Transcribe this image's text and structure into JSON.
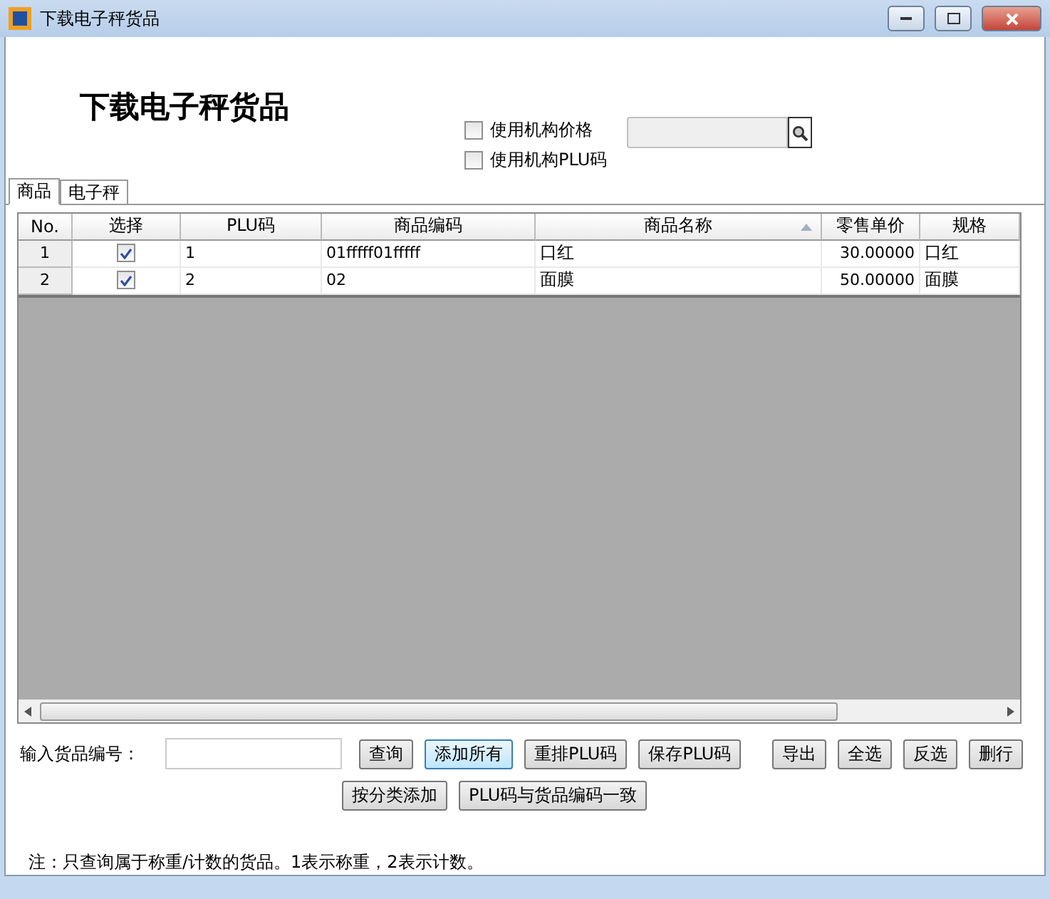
{
  "window": {
    "title": "下载电子秤货品"
  },
  "heading": "下载电子秤货品",
  "options": [
    {
      "label": "使用机构价格",
      "checked": false
    },
    {
      "label": "使用机构PLU码",
      "checked": false
    }
  ],
  "tabs": [
    {
      "label": "商品",
      "selected": true
    },
    {
      "label": "电子秤",
      "selected": false
    }
  ],
  "table": {
    "columns": [
      {
        "label": "No.",
        "sorted": false
      },
      {
        "label": "选择",
        "sorted": false
      },
      {
        "label": "PLU码",
        "sorted": false
      },
      {
        "label": "商品编码",
        "sorted": false
      },
      {
        "label": "商品名称",
        "sorted": true
      },
      {
        "label": "零售单价",
        "sorted": false
      },
      {
        "label": "规格",
        "sorted": false
      }
    ],
    "rows": [
      {
        "no": "1",
        "checked": true,
        "plu": "1",
        "code": "01fffff01fffff",
        "name": "口红",
        "price": "30.00000",
        "spec": "口红"
      },
      {
        "no": "2",
        "checked": true,
        "plu": "2",
        "code": "02",
        "name": "面膜",
        "price": "50.00000",
        "spec": "面膜"
      }
    ]
  },
  "input_label": "输入货品编号：",
  "buttons_row1": [
    {
      "label": "查询",
      "focused": false
    },
    {
      "label": "添加所有",
      "focused": true
    },
    {
      "label": "重排PLU码",
      "focused": false
    },
    {
      "label": "保存PLU码",
      "focused": false
    },
    {
      "label": "导出",
      "focused": false
    },
    {
      "label": "全选",
      "focused": false
    },
    {
      "label": "反选",
      "focused": false
    },
    {
      "label": "删行",
      "focused": false
    }
  ],
  "buttons_row2": [
    {
      "label": "按分类添加",
      "focused": false
    },
    {
      "label": "PLU码与货品编码一致",
      "focused": false
    }
  ],
  "note": "注：只查询属于称重/计数的货品。1表示称重，2表示计数。"
}
